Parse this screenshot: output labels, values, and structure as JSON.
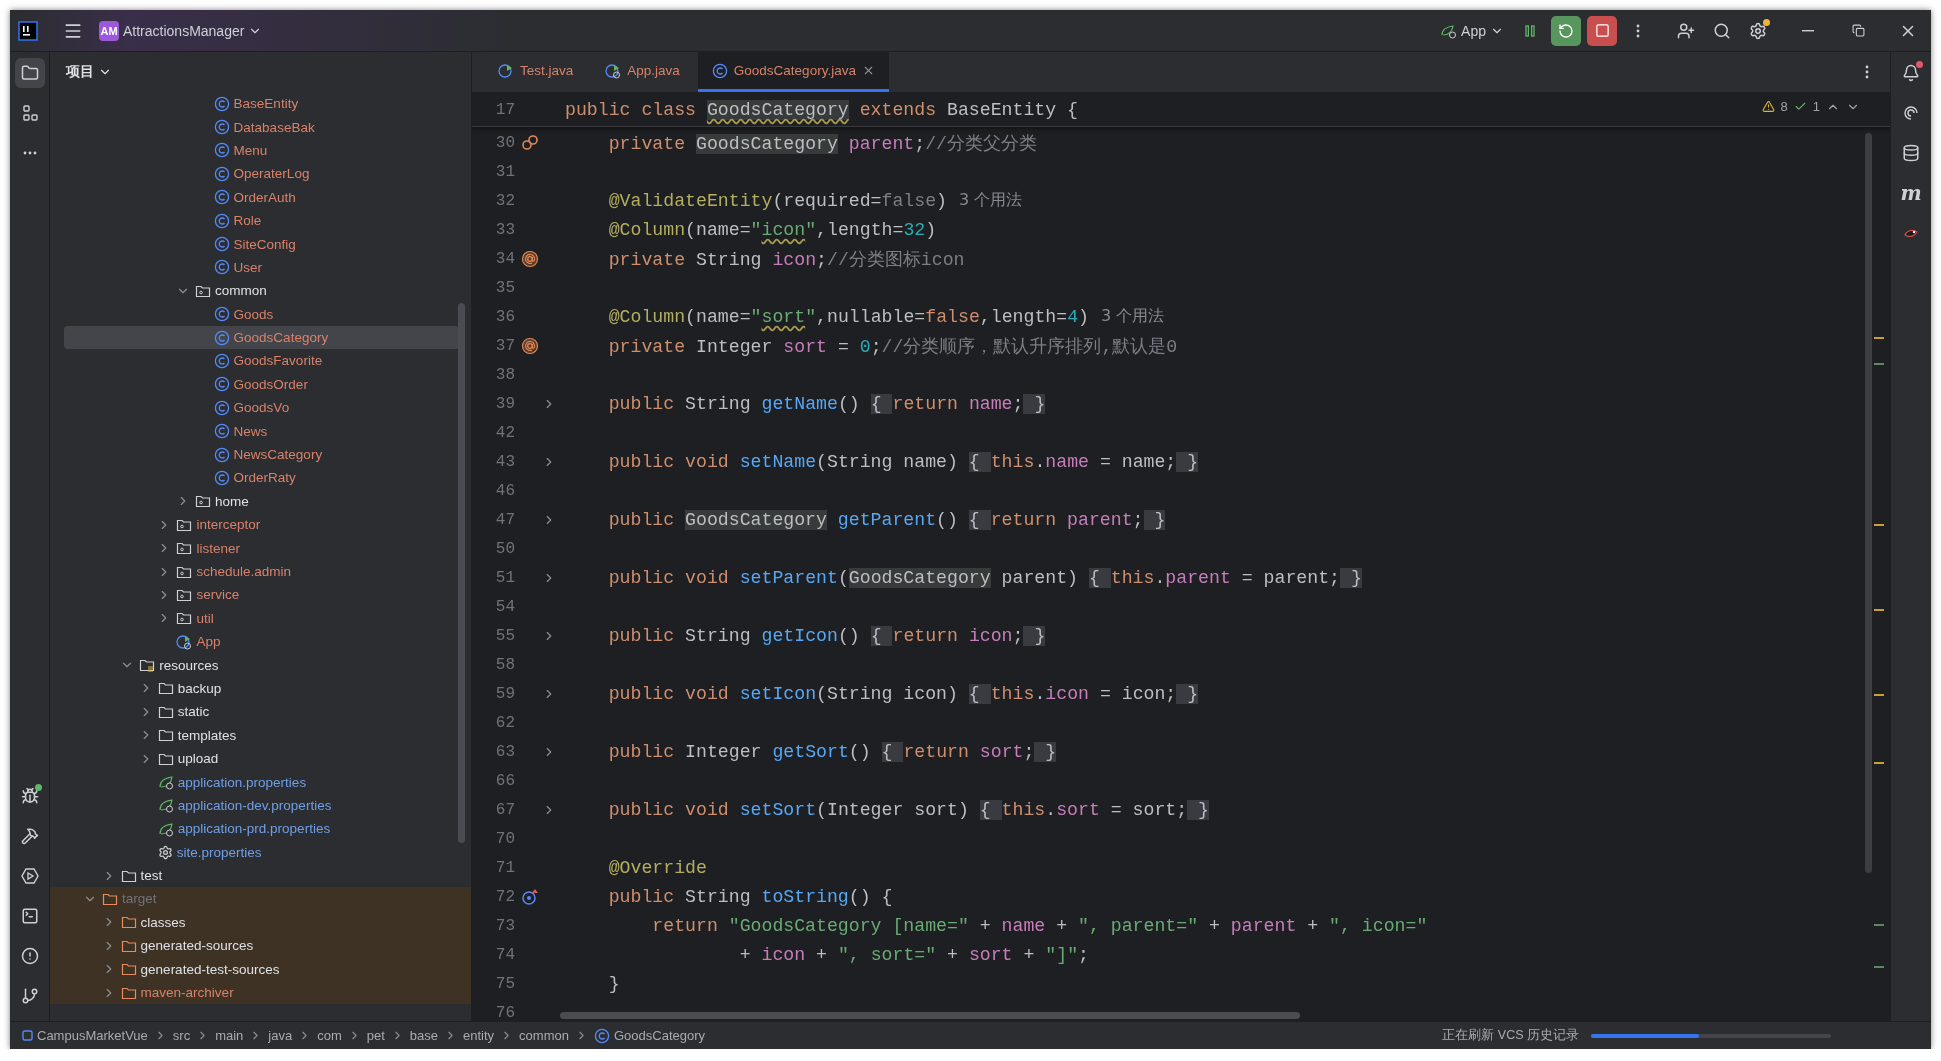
{
  "title_bar": {
    "project_badge": "AM",
    "project": "AttractionsManager",
    "run_config": "App"
  },
  "left_toolbar": {
    "top": [
      {
        "kind": "project",
        "selected": true
      },
      {
        "kind": "structure",
        "selected": false
      },
      {
        "kind": "more",
        "selected": false
      }
    ],
    "bottom": [
      {
        "kind": "debug"
      },
      {
        "kind": "build"
      },
      {
        "kind": "services"
      },
      {
        "kind": "terminal"
      },
      {
        "kind": "problems"
      },
      {
        "kind": "git"
      }
    ]
  },
  "right_toolbar": [
    {
      "kind": "notifications"
    },
    {
      "kind": "ai"
    },
    {
      "kind": "database"
    },
    {
      "kind": "maven",
      "glyph": "m"
    },
    {
      "kind": "plugin"
    }
  ],
  "project_panel": {
    "title": "项目",
    "tree": [
      {
        "children": [
          {
            "children": [
              {
                "children": [
                  {
                    "children": [
                      {
                        "children": [
                          {
                            "children": [
                              {
                                "label": "BaseEntity",
                                "kind": "class",
                                "color": "#d9826b",
                                "selected": false
                              },
                              {
                                "label": "DatabaseBak",
                                "kind": "class",
                                "color": "#d9826b",
                                "selected": false
                              },
                              {
                                "label": "Menu",
                                "kind": "class",
                                "color": "#d9826b",
                                "selected": false
                              },
                              {
                                "label": "OperaterLog",
                                "kind": "class",
                                "color": "#d9826b",
                                "selected": false
                              },
                              {
                                "label": "OrderAuth",
                                "kind": "class",
                                "color": "#d9826b",
                                "selected": false
                              },
                              {
                                "label": "Role",
                                "kind": "class",
                                "color": "#d9826b",
                                "selected": false
                              },
                              {
                                "label": "SiteConfig",
                                "kind": "class",
                                "color": "#d9826b",
                                "selected": false
                              },
                              {
                                "label": "User",
                                "kind": "class",
                                "color": "#d9826b",
                                "selected": false
                              }
                            ]
                          },
                          {
                            "label": "common",
                            "kind": "package",
                            "expanded": true,
                            "selected": false,
                            "children": [
                              {
                                "label": "Goods",
                                "kind": "class",
                                "color": "#d9826b",
                                "selected": false
                              },
                              {
                                "label": "GoodsCategory",
                                "kind": "class",
                                "color": "#d9826b",
                                "selected": true
                              },
                              {
                                "label": "GoodsFavorite",
                                "kind": "class",
                                "color": "#d9826b",
                                "selected": false
                              },
                              {
                                "label": "GoodsOrder",
                                "kind": "class",
                                "color": "#d9826b",
                                "selected": false
                              },
                              {
                                "label": "GoodsVo",
                                "kind": "class",
                                "color": "#d9826b",
                                "selected": false
                              },
                              {
                                "label": "News",
                                "kind": "class",
                                "color": "#d9826b",
                                "selected": false
                              },
                              {
                                "label": "NewsCategory",
                                "kind": "class",
                                "color": "#d9826b",
                                "selected": false
                              },
                              {
                                "label": "OrderRaty",
                                "kind": "class",
                                "color": "#d9826b",
                                "selected": false
                              }
                            ]
                          },
                          {
                            "label": "home",
                            "kind": "package",
                            "expanded": false,
                            "selected": false
                          }
                        ]
                      },
                      {
                        "label": "interceptor",
                        "kind": "package",
                        "color": "#d9826b",
                        "expanded": false,
                        "selected": false
                      },
                      {
                        "label": "listener",
                        "kind": "package",
                        "color": "#d9826b",
                        "expanded": false,
                        "selected": false
                      },
                      {
                        "label": "schedule.admin",
                        "kind": "package",
                        "color": "#d9826b",
                        "expanded": false,
                        "selected": false
                      },
                      {
                        "label": "service",
                        "kind": "package",
                        "color": "#d9826b",
                        "expanded": false,
                        "selected": false
                      },
                      {
                        "label": "util",
                        "kind": "package",
                        "color": "#d9826b",
                        "expanded": false,
                        "selected": false
                      },
                      {
                        "label": "App",
                        "kind": "app",
                        "color": "#d9826b",
                        "selected": false
                      }
                    ]
                  }
                ]
              },
              {
                "label": "resources",
                "kind": "resources",
                "expanded": true,
                "selected": false,
                "children": [
                  {
                    "label": "backup",
                    "kind": "folder",
                    "expanded": false,
                    "selected": false
                  },
                  {
                    "label": "static",
                    "kind": "folder",
                    "expanded": false,
                    "selected": false
                  },
                  {
                    "label": "templates",
                    "kind": "folder",
                    "expanded": false,
                    "selected": false
                  },
                  {
                    "label": "upload",
                    "kind": "folder",
                    "expanded": false,
                    "selected": false
                  },
                  {
                    "label": "application.properties",
                    "kind": "spring-properties",
                    "color": "#6f9fe6",
                    "selected": false
                  },
                  {
                    "label": "application-dev.properties",
                    "kind": "spring-properties",
                    "color": "#6f9fe6",
                    "selected": false
                  },
                  {
                    "label": "application-prd.properties",
                    "kind": "spring-properties",
                    "color": "#6f9fe6",
                    "selected": false
                  },
                  {
                    "label": "site.properties",
                    "kind": "properties",
                    "color": "#6f9fe6",
                    "selected": false
                  }
                ]
              }
            ]
          },
          {
            "label": "test",
            "kind": "folder",
            "expanded": false,
            "selected": false
          }
        ]
      },
      {
        "label": "target",
        "kind": "excluded-folder",
        "color": "#6f737a",
        "expanded": true,
        "selected": false,
        "children": [
          {
            "label": "classes",
            "kind": "excluded-folder",
            "expanded": false,
            "selected": false
          },
          {
            "label": "generated-sources",
            "kind": "excluded-folder",
            "expanded": false,
            "selected": false
          },
          {
            "label": "generated-test-sources",
            "kind": "excluded-folder",
            "expanded": false,
            "selected": false
          },
          {
            "label": "maven-archiver",
            "kind": "excluded-folder",
            "color": "#d9826b",
            "expanded": false,
            "selected": false
          }
        ]
      }
    ]
  },
  "editor": {
    "tabs": [
      {
        "label": "Test.java",
        "kind": "runnable",
        "selected": false
      },
      {
        "label": "App.java",
        "kind": "app",
        "selected": false
      },
      {
        "label": "GoodsCategory.java",
        "kind": "class",
        "selected": true
      }
    ],
    "inspections": {
      "warnings": "8",
      "weak_warnings": "1"
    },
    "sticky_line": {
      "number": "17",
      "tokens": [
        {
          "kind": "kw",
          "text": "public class "
        },
        {
          "kind": "usage",
          "text": "GoodsCategory",
          "typo": true
        },
        {
          "kind": "kw",
          "text": " extends "
        },
        {
          "kind": "plain",
          "text": "BaseEntity {"
        }
      ]
    },
    "lines": [
      {
        "number": "30",
        "gutter": {
          "kind": "relation"
        },
        "tokens": [
          {
            "kind": "kw",
            "text": "    private "
          },
          {
            "kind": "usage",
            "text": "GoodsCategory"
          },
          {
            "kind": "field",
            "text": " parent"
          },
          {
            "kind": "plain",
            "text": ";"
          },
          {
            "kind": "comment",
            "text": "//分类父分类"
          }
        ]
      },
      {
        "number": "31"
      },
      {
        "number": "32",
        "hint": "3 个用法",
        "tokens": [
          {
            "kind": "ann",
            "text": "    @ValidateEntity"
          },
          {
            "kind": "plain",
            "text": "(required="
          },
          {
            "kind": "dim",
            "text": "false"
          },
          {
            "kind": "plain",
            "text": ")"
          }
        ]
      },
      {
        "number": "33",
        "tokens": [
          {
            "kind": "ann",
            "text": "    @Column"
          },
          {
            "kind": "plain",
            "text": "(name="
          },
          {
            "kind": "str",
            "text": "\""
          },
          {
            "kind": "str",
            "text": "icon",
            "typo": true
          },
          {
            "kind": "str",
            "text": "\""
          },
          {
            "kind": "plain",
            "text": ",length="
          },
          {
            "kind": "num",
            "text": "32"
          },
          {
            "kind": "plain",
            "text": ")"
          }
        ]
      },
      {
        "number": "34",
        "gutter": {
          "kind": "annotation"
        },
        "tokens": [
          {
            "kind": "kw",
            "text": "    private "
          },
          {
            "kind": "plain",
            "text": "String "
          },
          {
            "kind": "field",
            "text": "icon"
          },
          {
            "kind": "plain",
            "text": ";"
          },
          {
            "kind": "comment",
            "text": "//分类图标icon"
          }
        ]
      },
      {
        "number": "35"
      },
      {
        "number": "36",
        "hint": "3 个用法",
        "tokens": [
          {
            "kind": "ann",
            "text": "    @Column"
          },
          {
            "kind": "plain",
            "text": "(name="
          },
          {
            "kind": "str",
            "text": "\""
          },
          {
            "kind": "str",
            "text": "sort",
            "typo": true
          },
          {
            "kind": "str",
            "text": "\""
          },
          {
            "kind": "plain",
            "text": ",nullable="
          },
          {
            "kind": "kw",
            "text": "false"
          },
          {
            "kind": "plain",
            "text": ",length="
          },
          {
            "kind": "num",
            "text": "4"
          },
          {
            "kind": "plain",
            "text": ")"
          }
        ]
      },
      {
        "number": "37",
        "gutter": {
          "kind": "annotation"
        },
        "tokens": [
          {
            "kind": "kw",
            "text": "    private "
          },
          {
            "kind": "plain",
            "text": "Integer "
          },
          {
            "kind": "field",
            "text": "sort"
          },
          {
            "kind": "plain",
            "text": " = "
          },
          {
            "kind": "num",
            "text": "0"
          },
          {
            "kind": "plain",
            "text": ";"
          },
          {
            "kind": "comment",
            "text": "//分类顺序，默认升序排列,默认是0"
          }
        ]
      },
      {
        "number": "38"
      },
      {
        "number": "39",
        "folded": true,
        "tokens": [
          {
            "kind": "kw",
            "text": "    public "
          },
          {
            "kind": "plain",
            "text": "String "
          },
          {
            "kind": "decl",
            "text": "getName"
          },
          {
            "kind": "plain",
            "text": "() "
          },
          {
            "kind": "fold",
            "text": "{ "
          },
          {
            "kind": "kw",
            "text": "return "
          },
          {
            "kind": "field",
            "text": "name"
          },
          {
            "kind": "plain",
            "text": ";"
          },
          {
            "kind": "fold",
            "text": " }"
          }
        ]
      },
      {
        "number": "42"
      },
      {
        "number": "43",
        "folded": true,
        "tokens": [
          {
            "kind": "kw",
            "text": "    public void "
          },
          {
            "kind": "decl",
            "text": "setName"
          },
          {
            "kind": "plain",
            "text": "(String name) "
          },
          {
            "kind": "fold",
            "text": "{ "
          },
          {
            "kind": "kw",
            "text": "this"
          },
          {
            "kind": "plain",
            "text": "."
          },
          {
            "kind": "field",
            "text": "name"
          },
          {
            "kind": "plain",
            "text": " = name;"
          },
          {
            "kind": "fold",
            "text": " }"
          }
        ]
      },
      {
        "number": "46"
      },
      {
        "number": "47",
        "folded": true,
        "tokens": [
          {
            "kind": "kw",
            "text": "    public "
          },
          {
            "kind": "usage",
            "text": "GoodsCategory"
          },
          {
            "kind": "decl",
            "text": " getParent"
          },
          {
            "kind": "plain",
            "text": "() "
          },
          {
            "kind": "fold",
            "text": "{ "
          },
          {
            "kind": "kw",
            "text": "return "
          },
          {
            "kind": "field",
            "text": "parent"
          },
          {
            "kind": "plain",
            "text": ";"
          },
          {
            "kind": "fold",
            "text": " }"
          }
        ]
      },
      {
        "number": "50"
      },
      {
        "number": "51",
        "folded": true,
        "tokens": [
          {
            "kind": "kw",
            "text": "    public void "
          },
          {
            "kind": "decl",
            "text": "setParent"
          },
          {
            "kind": "plain",
            "text": "("
          },
          {
            "kind": "usage",
            "text": "GoodsCategory"
          },
          {
            "kind": "plain",
            "text": " parent) "
          },
          {
            "kind": "fold",
            "text": "{ "
          },
          {
            "kind": "kw",
            "text": "this"
          },
          {
            "kind": "plain",
            "text": "."
          },
          {
            "kind": "field",
            "text": "parent"
          },
          {
            "kind": "plain",
            "text": " = parent;"
          },
          {
            "kind": "fold",
            "text": " }"
          }
        ]
      },
      {
        "number": "54"
      },
      {
        "number": "55",
        "folded": true,
        "tokens": [
          {
            "kind": "kw",
            "text": "    public "
          },
          {
            "kind": "plain",
            "text": "String "
          },
          {
            "kind": "decl",
            "text": "getIcon"
          },
          {
            "kind": "plain",
            "text": "() "
          },
          {
            "kind": "fold",
            "text": "{ "
          },
          {
            "kind": "kw",
            "text": "return "
          },
          {
            "kind": "field",
            "text": "icon"
          },
          {
            "kind": "plain",
            "text": ";"
          },
          {
            "kind": "fold",
            "text": " }"
          }
        ]
      },
      {
        "number": "58"
      },
      {
        "number": "59",
        "folded": true,
        "tokens": [
          {
            "kind": "kw",
            "text": "    public void "
          },
          {
            "kind": "decl",
            "text": "setIcon"
          },
          {
            "kind": "plain",
            "text": "(String icon) "
          },
          {
            "kind": "fold",
            "text": "{ "
          },
          {
            "kind": "kw",
            "text": "this"
          },
          {
            "kind": "plain",
            "text": "."
          },
          {
            "kind": "field",
            "text": "icon"
          },
          {
            "kind": "plain",
            "text": " = icon;"
          },
          {
            "kind": "fold",
            "text": " }"
          }
        ]
      },
      {
        "number": "62"
      },
      {
        "number": "63",
        "folded": true,
        "tokens": [
          {
            "kind": "kw",
            "text": "    public "
          },
          {
            "kind": "plain",
            "text": "Integer "
          },
          {
            "kind": "decl",
            "text": "getSort"
          },
          {
            "kind": "plain",
            "text": "() "
          },
          {
            "kind": "fold",
            "text": "{ "
          },
          {
            "kind": "kw",
            "text": "return "
          },
          {
            "kind": "field",
            "text": "sort"
          },
          {
            "kind": "plain",
            "text": ";"
          },
          {
            "kind": "fold",
            "text": " }"
          }
        ]
      },
      {
        "number": "66"
      },
      {
        "number": "67",
        "folded": true,
        "tokens": [
          {
            "kind": "kw",
            "text": "    public void "
          },
          {
            "kind": "decl",
            "text": "setSort"
          },
          {
            "kind": "plain",
            "text": "(Integer sort) "
          },
          {
            "kind": "fold",
            "text": "{ "
          },
          {
            "kind": "kw",
            "text": "this"
          },
          {
            "kind": "plain",
            "text": "."
          },
          {
            "kind": "field",
            "text": "sort"
          },
          {
            "kind": "plain",
            "text": " = sort;"
          },
          {
            "kind": "fold",
            "text": " }"
          }
        ]
      },
      {
        "number": "70"
      },
      {
        "number": "71",
        "tokens": [
          {
            "kind": "ann",
            "text": "    @Override"
          }
        ]
      },
      {
        "number": "72",
        "gutter": {
          "kind": "override"
        },
        "tokens": [
          {
            "kind": "kw",
            "text": "    public "
          },
          {
            "kind": "plain",
            "text": "String "
          },
          {
            "kind": "decl",
            "text": "toString"
          },
          {
            "kind": "plain",
            "text": "() {"
          }
        ]
      },
      {
        "number": "73",
        "tokens": [
          {
            "kind": "kw",
            "text": "        return "
          },
          {
            "kind": "str",
            "text": "\"GoodsCategory [name=\""
          },
          {
            "kind": "plain",
            "text": " + "
          },
          {
            "kind": "field",
            "text": "name"
          },
          {
            "kind": "plain",
            "text": " + "
          },
          {
            "kind": "str",
            "text": "\", parent=\""
          },
          {
            "kind": "plain",
            "text": " + "
          },
          {
            "kind": "field",
            "text": "parent"
          },
          {
            "kind": "plain",
            "text": " + "
          },
          {
            "kind": "str",
            "text": "\", icon=\""
          }
        ]
      },
      {
        "number": "74",
        "tokens": [
          {
            "kind": "plain",
            "text": "                + "
          },
          {
            "kind": "field",
            "text": "icon"
          },
          {
            "kind": "plain",
            "text": " + "
          },
          {
            "kind": "str",
            "text": "\", sort=\""
          },
          {
            "kind": "plain",
            "text": " + "
          },
          {
            "kind": "field",
            "text": "sort"
          },
          {
            "kind": "plain",
            "text": " + "
          },
          {
            "kind": "str",
            "text": "\"]\""
          },
          {
            "kind": "plain",
            "text": ";"
          }
        ]
      },
      {
        "number": "75",
        "tokens": [
          {
            "kind": "plain",
            "text": "    }"
          }
        ]
      },
      {
        "number": "76"
      }
    ]
  },
  "status_bar": {
    "breadcrumbs": [
      {
        "label": "CampusMarketVue",
        "kind": "module"
      },
      {
        "label": "src",
        "kind": "folder"
      },
      {
        "label": "main",
        "kind": "folder"
      },
      {
        "label": "java",
        "kind": "folder"
      },
      {
        "label": "com",
        "kind": "folder"
      },
      {
        "label": "pet",
        "kind": "folder"
      },
      {
        "label": "base",
        "kind": "folder"
      },
      {
        "label": "entity",
        "kind": "folder"
      },
      {
        "label": "common",
        "kind": "folder"
      },
      {
        "label": "GoodsCategory",
        "kind": "class"
      }
    ],
    "task": "正在刷新 VCS 历史记录",
    "progress": {
      "level": 0.45
    }
  }
}
